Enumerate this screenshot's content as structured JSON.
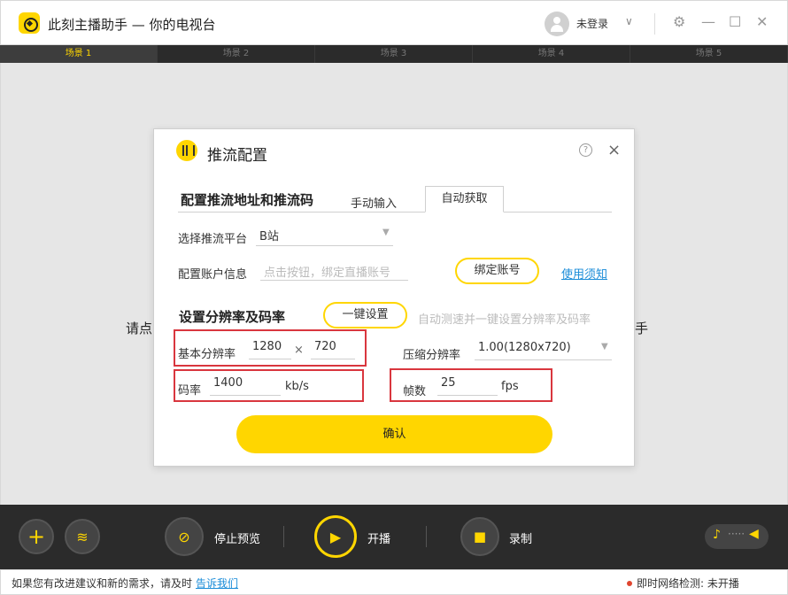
{
  "app": {
    "title": "此刻主播助手 — 你的电视台",
    "login_status": "未登录"
  },
  "scene_tabs": [
    "场景 1",
    "场景 2",
    "场景 3",
    "场景 4",
    "场景 5"
  ],
  "canvas": {
    "text_left": "请点",
    "text_right": "手"
  },
  "dialog": {
    "title": "推流配置",
    "help_glyph": "?",
    "close_glyph": "×",
    "section1_title": "配置推流地址和推流码",
    "tabs": {
      "manual": "手动输入",
      "auto": "自动获取"
    },
    "platform_label": "选择推流平台",
    "platform_value": "B站",
    "account_label": "配置账户信息",
    "account_placeholder": "点击按钮，绑定直播账号",
    "bind_button": "绑定账号",
    "usage_link": "使用须知",
    "section2_title": "设置分辨率及码率",
    "one_click_button": "一键设置",
    "auto_hint": "自动测速并一键设置分辨率及码率",
    "base_res_label": "基本分辨率",
    "base_width": "1280",
    "times": "×",
    "base_height": "720",
    "compress_label": "压缩分辨率",
    "compress_value": "1.00(1280x720)",
    "bitrate_label": "码率",
    "bitrate_value": "1400",
    "bitrate_unit": "kb/s",
    "fps_label": "帧数",
    "fps_value": "25",
    "fps_unit": "fps",
    "confirm_button": "确认"
  },
  "bottombar": {
    "stop_preview": "停止预览",
    "start_stream": "开播",
    "record": "录制"
  },
  "statusbar": {
    "feedback_text": "如果您有改进建议和新的需求，请及时",
    "feedback_link": "告诉我们",
    "network_label": "即时网络检测:",
    "network_status": "未开播"
  },
  "colors": {
    "accent": "#ffd600",
    "highlight": "#d9363e",
    "link": "#1a8cd8"
  }
}
